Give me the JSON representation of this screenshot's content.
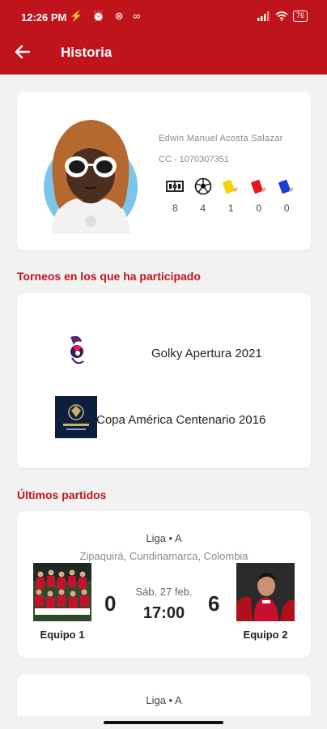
{
  "status_bar": {
    "time": "12:26 PM",
    "left_icons": "⚡ ⏰ ⊗ ∞",
    "battery": "76"
  },
  "app_bar": {
    "title": "Historia",
    "back_icon": "arrow-left-icon"
  },
  "colors": {
    "primary": "#c0141c",
    "background": "#f2f2f2",
    "card": "#ffffff",
    "yellow_card": "#f5d300",
    "red_card": "#e01a1a",
    "blue_card": "#1a3fd6"
  },
  "profile": {
    "name": "Edwin Manuel  Acosta Salazar",
    "document": "CC - 1070307351",
    "stats": [
      {
        "icon": "matches-played-icon",
        "value": "8"
      },
      {
        "icon": "soccer-ball-icon",
        "value": "4"
      },
      {
        "icon": "yellow-card-icon",
        "value": "1"
      },
      {
        "icon": "red-card-icon",
        "value": "0"
      },
      {
        "icon": "blue-card-icon",
        "value": "0"
      }
    ]
  },
  "sections": {
    "tournaments_title": "Torneos en los que ha participado",
    "matches_title": "Últimos partidos"
  },
  "tournaments": [
    {
      "name": "Golky Apertura 2021"
    },
    {
      "name": "Copa América Centenario 2016"
    }
  ],
  "matches": [
    {
      "league": "Liga • A",
      "location": "Zipaquirá, Cundinamarca, Colombia",
      "date": "Sáb. 27 feb.",
      "time": "17:00",
      "home_team": "Equipo 1",
      "away_team": "Equipo 2",
      "home_score": "0",
      "away_score": "6"
    },
    {
      "league": "Liga • A"
    }
  ]
}
